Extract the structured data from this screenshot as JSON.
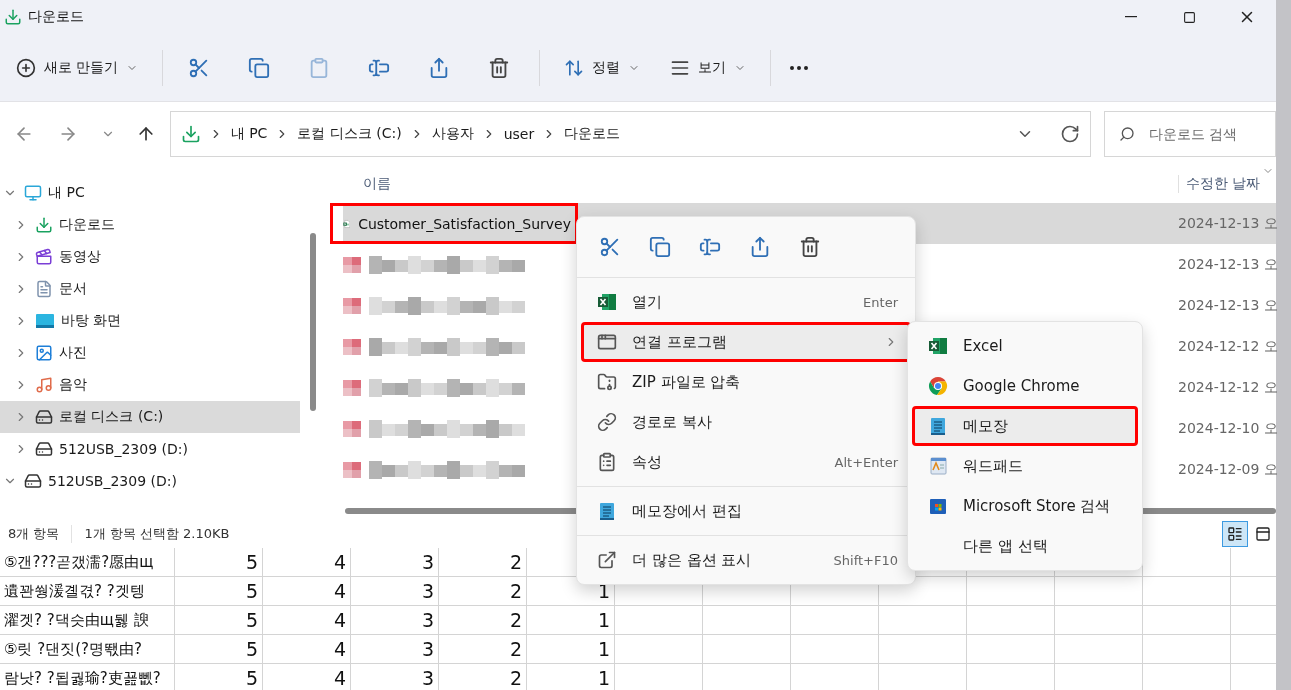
{
  "window": {
    "title": "다운로드"
  },
  "toolbar": {
    "new_button": "새로 만들기",
    "actions": [
      {
        "disabled": false
      },
      {
        "disabled": false
      },
      {
        "disabled": true
      },
      {
        "disabled": false
      },
      {
        "disabled": false
      },
      {
        "disabled": false
      }
    ],
    "sort_button": "정렬",
    "view_button": "보기"
  },
  "address_bar": {
    "path": [
      "내 PC",
      "로컬 디스크 (C:)",
      "사용자",
      "user",
      "다운로드"
    ]
  },
  "search": {
    "placeholder": "다운로드 검색"
  },
  "nav_pane": {
    "items": [
      {
        "label": "내 PC",
        "expanded": true,
        "selected": false,
        "children": [
          {
            "label": "다운로드",
            "expanded": false,
            "selected": false
          },
          {
            "label": "동영상",
            "expanded": false,
            "selected": false
          },
          {
            "label": "문서",
            "expanded": false,
            "selected": false
          },
          {
            "label": "바탕 화면",
            "expanded": false,
            "selected": false
          },
          {
            "label": "사진",
            "expanded": false,
            "selected": false
          },
          {
            "label": "음악",
            "expanded": false,
            "selected": false
          },
          {
            "label": "로컬 디스크 (C:)",
            "expanded": false,
            "selected": true
          },
          {
            "label": "512USB_2309 (D:)",
            "expanded": false,
            "selected": false
          }
        ]
      },
      {
        "label": "512USB_2309 (D:)",
        "expanded": true,
        "selected": false
      }
    ]
  },
  "file_list": {
    "columns": [
      "이름",
      "수정한 날짜"
    ],
    "rows": [
      {
        "kind": "file",
        "name": "Customer_Satisfaction_Survey",
        "date": "2024-12-13 오",
        "selected": true,
        "highlighted": true
      },
      {
        "kind": "redacted",
        "date": "2024-12-13 오",
        "selected": false,
        "highlighted": false
      },
      {
        "kind": "redacted",
        "date": "2024-12-13 오",
        "selected": false,
        "highlighted": false
      },
      {
        "kind": "redacted",
        "date": "2024-12-12 오",
        "selected": false,
        "highlighted": false
      },
      {
        "kind": "redacted",
        "date": "2024-12-12 오",
        "selected": false,
        "highlighted": false
      },
      {
        "kind": "redacted",
        "date": "2024-12-10 오",
        "selected": false,
        "highlighted": false
      },
      {
        "kind": "redacted",
        "date": "2024-12-09 오",
        "selected": false,
        "highlighted": false
      }
    ]
  },
  "status_bar": {
    "item_count": "8개 항목",
    "selection": "1개 항목 선택함 2.10KB",
    "views": [
      {
        "selected": true
      },
      {
        "selected": false
      }
    ]
  },
  "context_menu": {
    "groups": [
      [
        {
          "label": "열기",
          "shortcut": "Enter",
          "hovered": false,
          "highlighted": false,
          "submenu": false
        },
        {
          "label": "연결 프로그램",
          "hovered": true,
          "highlighted": true,
          "submenu": true
        },
        {
          "label": "ZIP 파일로 압축",
          "hovered": false,
          "highlighted": false,
          "submenu": false
        },
        {
          "label": "경로로 복사",
          "hovered": false,
          "highlighted": false,
          "submenu": false
        },
        {
          "label": "속성",
          "shortcut": "Alt+Enter",
          "hovered": false,
          "highlighted": false,
          "submenu": false
        }
      ],
      [
        {
          "label": "메모장에서 편집",
          "hovered": false,
          "highlighted": false,
          "submenu": false
        }
      ],
      [
        {
          "label": "더 많은 옵션 표시",
          "shortcut": "Shift+F10",
          "hovered": false,
          "highlighted": false,
          "submenu": false
        }
      ]
    ]
  },
  "submenu": {
    "items": [
      {
        "label": "Excel",
        "hovered": false,
        "highlighted": false
      },
      {
        "label": "Google Chrome",
        "hovered": false,
        "highlighted": false
      },
      {
        "label": "메모장",
        "hovered": true,
        "highlighted": true
      },
      {
        "label": "워드패드",
        "hovered": false,
        "highlighted": false
      },
      {
        "label": "Microsoft Store 검색",
        "hovered": false,
        "highlighted": false
      },
      {
        "label": "다른 앱 선택",
        "hovered": false,
        "highlighted": false
      }
    ]
  },
  "spreadsheet": {
    "rows": [
      {
        "cells": [
          "⑤갠???곧갰濡?愿由щ",
          "5",
          "4",
          "3",
          "2"
        ]
      },
      {
        "cells": [
          "遺꽌쒕湲곌겫? ?겟텡",
          "5",
          "4",
          "3",
          "2",
          "1"
        ]
      },
      {
        "cells": [
          "濯겟? ?댁슷由щ뒗 諛",
          "5",
          "4",
          "3",
          "2",
          "1"
        ]
      },
      {
        "cells": [
          "⑤릿 ?댄짓(?명뙋由?",
          "5",
          "4",
          "3",
          "2",
          "1"
        ]
      },
      {
        "cells": [
          "람낫? ?됩궗瑜?吏꾪뻾?",
          "5",
          "4",
          "3",
          "2",
          "1"
        ]
      }
    ]
  }
}
